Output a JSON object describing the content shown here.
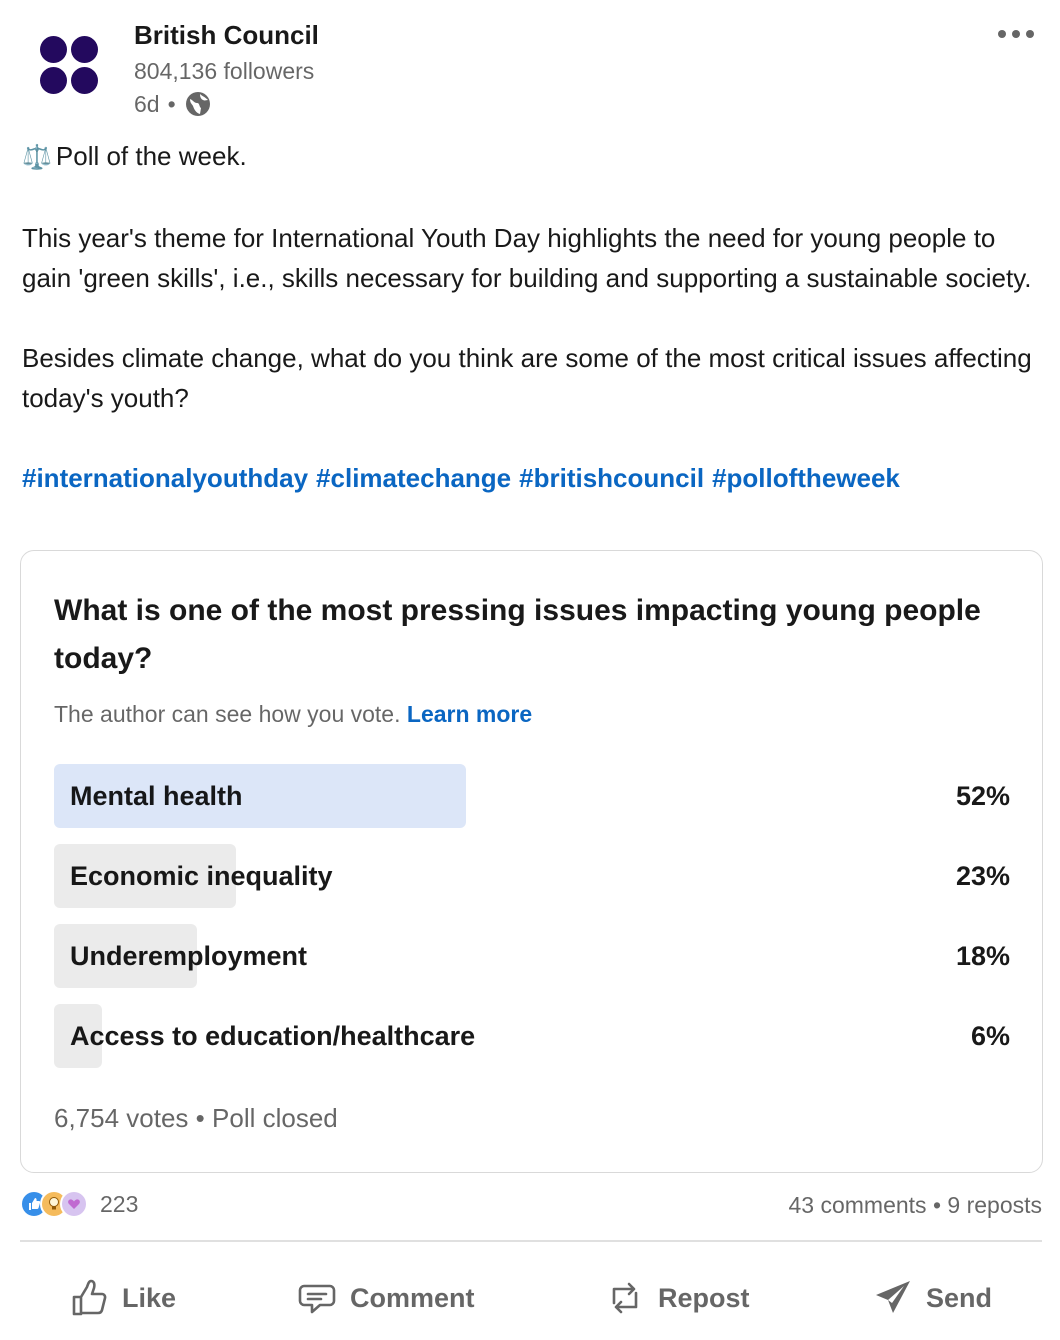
{
  "post": {
    "author": "British Council",
    "followers": "804,136 followers",
    "time": "6d",
    "separator": "•",
    "brand_color": "#23095e",
    "icons": {
      "visibility": "globe-icon",
      "menu": "more-icon"
    }
  },
  "body": {
    "line1": "Poll of the week.",
    "para2": "This year's theme for International Youth Day highlights the need for young people to gain 'green skills', i.e., skills necessary for building and supporting a sustainable society.",
    "para3": "Besides climate change, what do you think are some of the most critical issues affecting today's youth?",
    "hashtags": [
      "#internationalyouthday",
      "#climatechange",
      "#britishcouncil",
      "#polloftheweek"
    ]
  },
  "poll": {
    "question": "What is one of the most pressing issues impacting young people today?",
    "note": "The author can see how you vote.",
    "learn_more": "Learn more",
    "options": [
      {
        "label": "Mental health",
        "percent": "52%",
        "share": 0.52,
        "winner": true
      },
      {
        "label": "Economic inequality",
        "percent": "23%",
        "share": 0.23,
        "winner": false
      },
      {
        "label": "Underemployment",
        "percent": "18%",
        "share": 0.18,
        "winner": false
      },
      {
        "label": "Access to education/healthcare",
        "percent": "6%",
        "share": 0.06,
        "winner": false
      }
    ],
    "votes": "6,754 votes",
    "status": "Poll closed",
    "winner_color": "#dce6f8",
    "bar_color": "#ebebeb"
  },
  "social": {
    "reaction_count": "223",
    "comments": "43 comments",
    "reposts": "9 reposts",
    "reactions": [
      "like-icon",
      "insightful-icon",
      "support-icon"
    ]
  },
  "actions": {
    "like": "Like",
    "comment": "Comment",
    "repost": "Repost",
    "send": "Send"
  },
  "accent": "#0a66c2"
}
